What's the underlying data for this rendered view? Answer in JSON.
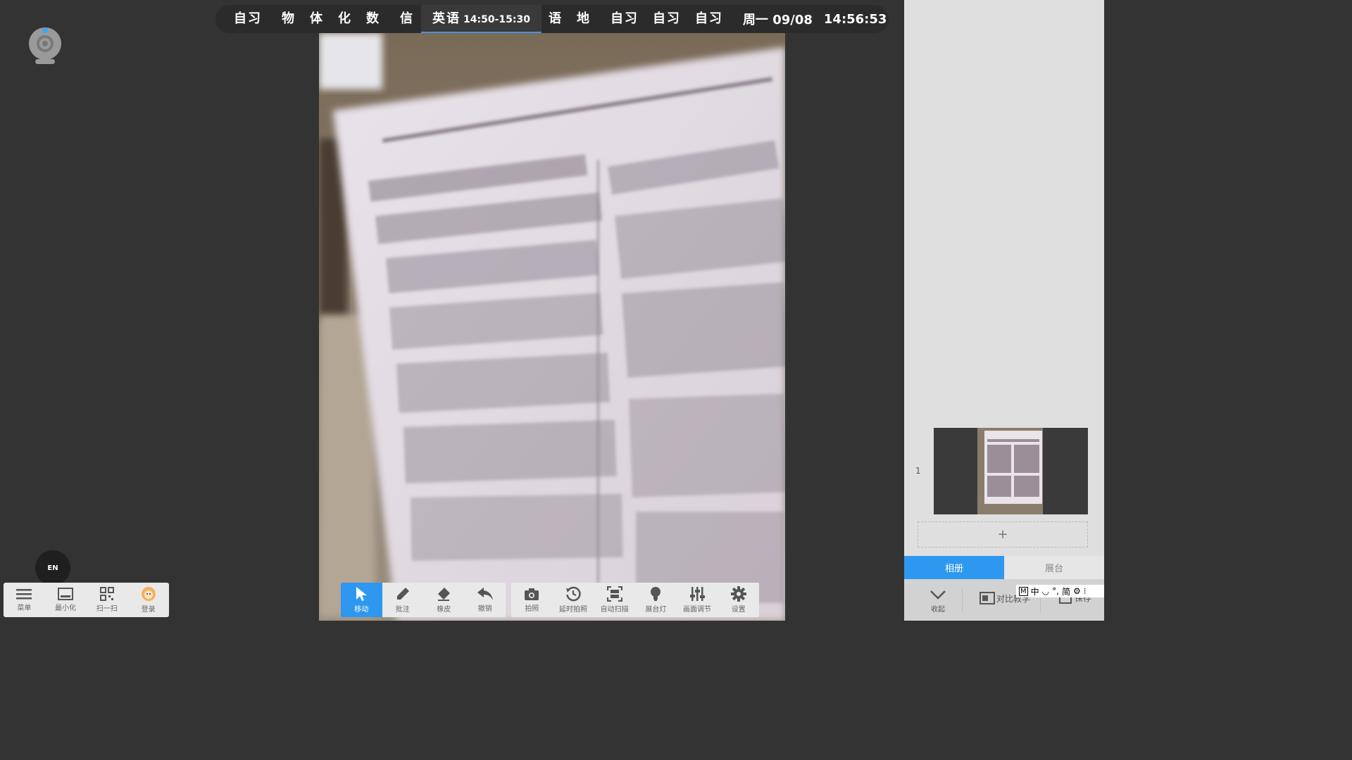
{
  "schedule": {
    "items": [
      {
        "label": "自习"
      },
      {
        "label": "物"
      },
      {
        "label": "体"
      },
      {
        "label": "化"
      },
      {
        "label": "数"
      },
      {
        "label": "信"
      },
      {
        "label": "英语",
        "time": "14:50-15:30"
      },
      {
        "label": "语"
      },
      {
        "label": "地"
      },
      {
        "label": "自习"
      },
      {
        "label": "自习"
      },
      {
        "label": "自习"
      }
    ],
    "date": "周一 09/08",
    "clock": "14:56:53"
  },
  "webcam_icon": "webcam-icon",
  "lang_button": "EN",
  "left_toolbar": [
    {
      "label": "菜单",
      "icon": "menu-icon"
    },
    {
      "label": "最小化",
      "icon": "minimize-icon"
    },
    {
      "label": "扫一扫",
      "icon": "qr-code-icon"
    },
    {
      "label": "登录",
      "icon": "avatar-icon"
    }
  ],
  "edit_toolbar": [
    {
      "label": "移动",
      "icon": "cursor-icon",
      "active": true
    },
    {
      "label": "批注",
      "icon": "pen-icon"
    },
    {
      "label": "橡皮",
      "icon": "eraser-icon"
    },
    {
      "label": "撤销",
      "icon": "undo-icon"
    }
  ],
  "camera_toolbar": [
    {
      "label": "拍照",
      "icon": "camera-icon"
    },
    {
      "label": "延时拍照",
      "icon": "timer-icon"
    },
    {
      "label": "自动扫描",
      "icon": "scan-icon"
    },
    {
      "label": "展台灯",
      "icon": "lamp-icon"
    },
    {
      "label": "画面调节",
      "icon": "sliders-icon"
    },
    {
      "label": "设置",
      "icon": "gear-icon"
    }
  ],
  "panel": {
    "thumb_index": "1",
    "add_label": "+",
    "tabs": [
      {
        "label": "相册",
        "active": true
      },
      {
        "label": "展台",
        "active": false
      }
    ],
    "collapse_label": "收起",
    "compare_label": "对比教学",
    "save_label": "保存"
  },
  "ime": {
    "mode": "M",
    "lang": "中",
    "script": "简"
  },
  "colors": {
    "accent": "#2e98f0",
    "background": "#333333",
    "panel": "#dfdfdf"
  }
}
